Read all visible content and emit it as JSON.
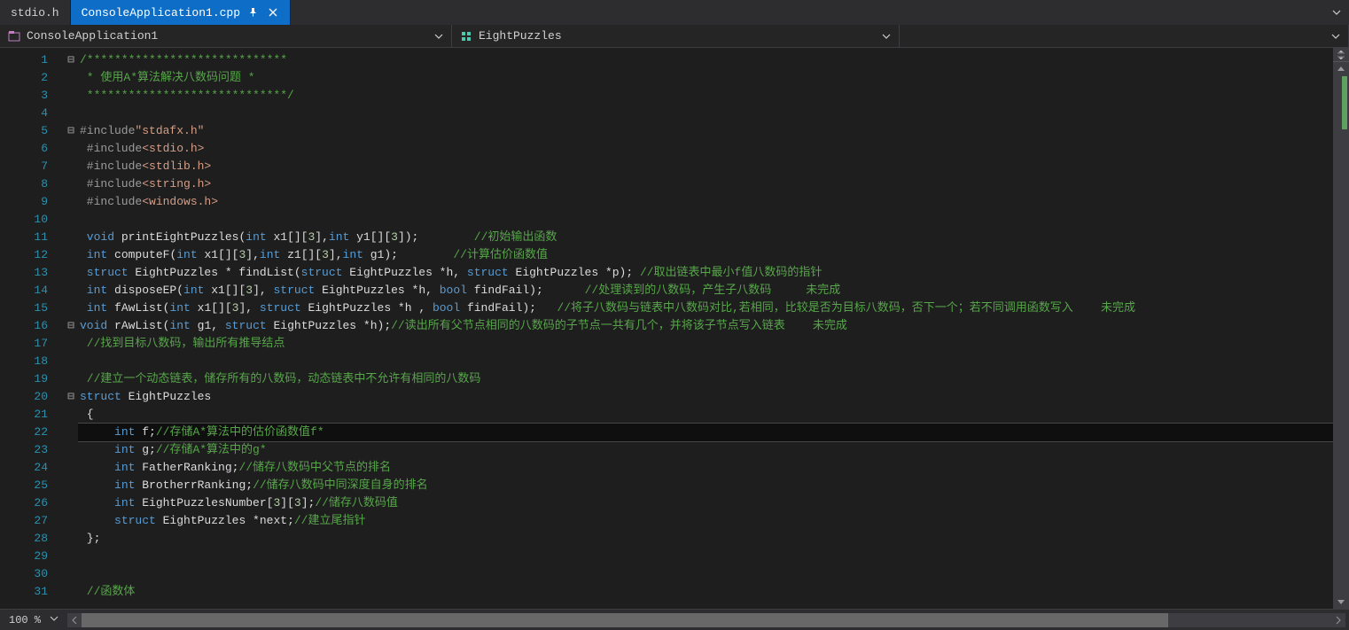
{
  "tabs": [
    {
      "label": "stdio.h",
      "active": false
    },
    {
      "label": "ConsoleApplication1.cpp",
      "active": true
    }
  ],
  "nav": {
    "scope": "ConsoleApplication1",
    "member": "EightPuzzles"
  },
  "zoom": "100 %",
  "lines": [
    {
      "n": 1,
      "fold": "⊟",
      "tokens": [
        [
          "c-comment",
          "/*****************************"
        ]
      ]
    },
    {
      "n": 2,
      "fold": "",
      "tokens": [
        [
          "c-comment",
          " * 使用A*算法解决八数码问题 *"
        ]
      ]
    },
    {
      "n": 3,
      "fold": "",
      "tokens": [
        [
          "c-comment",
          " *****************************/"
        ]
      ]
    },
    {
      "n": 4,
      "fold": "",
      "tokens": []
    },
    {
      "n": 5,
      "fold": "⊟",
      "tokens": [
        [
          "c-pre",
          "#include"
        ],
        [
          "c-string",
          "\"stdafx.h\""
        ]
      ]
    },
    {
      "n": 6,
      "fold": "",
      "tokens": [
        [
          "c-pre",
          " #include"
        ],
        [
          "c-string",
          "<stdio.h>"
        ]
      ]
    },
    {
      "n": 7,
      "fold": "",
      "tokens": [
        [
          "c-pre",
          " #include"
        ],
        [
          "c-string",
          "<stdlib.h>"
        ]
      ]
    },
    {
      "n": 8,
      "fold": "",
      "tokens": [
        [
          "c-pre",
          " #include"
        ],
        [
          "c-string",
          "<string.h>"
        ]
      ]
    },
    {
      "n": 9,
      "fold": "",
      "tokens": [
        [
          "c-pre",
          " #include"
        ],
        [
          "c-string",
          "<windows.h>"
        ]
      ]
    },
    {
      "n": 10,
      "fold": "",
      "tokens": []
    },
    {
      "n": 11,
      "fold": "",
      "tokens": [
        [
          "c-keyword",
          " void"
        ],
        [
          "c-func",
          " printEightPuzzles"
        ],
        [
          "c-punct",
          "("
        ],
        [
          "c-keyword",
          "int"
        ],
        [
          "c-func",
          " x1"
        ],
        [
          "c-punct",
          "[]["
        ],
        [
          "c-num",
          "3"
        ],
        [
          "c-punct",
          "],"
        ],
        [
          "c-keyword",
          "int"
        ],
        [
          "c-func",
          " y1"
        ],
        [
          "c-punct",
          "[]["
        ],
        [
          "c-num",
          "3"
        ],
        [
          "c-punct",
          "]);        "
        ],
        [
          "c-comment",
          "//初始输出函数"
        ]
      ]
    },
    {
      "n": 12,
      "fold": "",
      "tokens": [
        [
          "c-keyword",
          " int"
        ],
        [
          "c-func",
          " computeF"
        ],
        [
          "c-punct",
          "("
        ],
        [
          "c-keyword",
          "int"
        ],
        [
          "c-func",
          " x1"
        ],
        [
          "c-punct",
          "[]["
        ],
        [
          "c-num",
          "3"
        ],
        [
          "c-punct",
          "],"
        ],
        [
          "c-keyword",
          "int"
        ],
        [
          "c-func",
          " z1"
        ],
        [
          "c-punct",
          "[]["
        ],
        [
          "c-num",
          "3"
        ],
        [
          "c-punct",
          "],"
        ],
        [
          "c-keyword",
          "int"
        ],
        [
          "c-func",
          " g1"
        ],
        [
          "c-punct",
          ");        "
        ],
        [
          "c-comment",
          "//计算估价函数值"
        ]
      ]
    },
    {
      "n": 13,
      "fold": "",
      "tokens": [
        [
          "c-keyword",
          " struct"
        ],
        [
          "c-func",
          " EightPuzzles * findList"
        ],
        [
          "c-punct",
          "("
        ],
        [
          "c-keyword",
          "struct"
        ],
        [
          "c-func",
          " EightPuzzles *h"
        ],
        [
          "c-punct",
          ", "
        ],
        [
          "c-keyword",
          "struct"
        ],
        [
          "c-func",
          " EightPuzzles *p"
        ],
        [
          "c-punct",
          "); "
        ],
        [
          "c-comment",
          "//取出链表中最小f值八数码的指针"
        ]
      ]
    },
    {
      "n": 14,
      "fold": "",
      "tokens": [
        [
          "c-keyword",
          " int"
        ],
        [
          "c-func",
          " disposeEP"
        ],
        [
          "c-punct",
          "("
        ],
        [
          "c-keyword",
          "int"
        ],
        [
          "c-func",
          " x1"
        ],
        [
          "c-punct",
          "[]["
        ],
        [
          "c-num",
          "3"
        ],
        [
          "c-punct",
          "], "
        ],
        [
          "c-keyword",
          "struct"
        ],
        [
          "c-func",
          " EightPuzzles *h"
        ],
        [
          "c-punct",
          ", "
        ],
        [
          "c-keyword",
          "bool"
        ],
        [
          "c-func",
          " findFail"
        ],
        [
          "c-punct",
          ");      "
        ],
        [
          "c-comment",
          "//处理读到的八数码，产生子八数码     未完成"
        ]
      ]
    },
    {
      "n": 15,
      "fold": "",
      "tokens": [
        [
          "c-keyword",
          " int"
        ],
        [
          "c-func",
          " fAwList"
        ],
        [
          "c-punct",
          "("
        ],
        [
          "c-keyword",
          "int"
        ],
        [
          "c-func",
          " x1"
        ],
        [
          "c-punct",
          "[]["
        ],
        [
          "c-num",
          "3"
        ],
        [
          "c-punct",
          "], "
        ],
        [
          "c-keyword",
          "struct"
        ],
        [
          "c-func",
          " EightPuzzles *h "
        ],
        [
          "c-punct",
          ", "
        ],
        [
          "c-keyword",
          "bool"
        ],
        [
          "c-func",
          " findFail"
        ],
        [
          "c-punct",
          ");   "
        ],
        [
          "c-comment",
          "//将子八数码与链表中八数码对比,若相同，比较是否为目标八数码，否下一个；若不同调用函数写入    未完成"
        ]
      ]
    },
    {
      "n": 16,
      "fold": "⊟",
      "tokens": [
        [
          "c-keyword",
          "void"
        ],
        [
          "c-func",
          " rAwList"
        ],
        [
          "c-punct",
          "("
        ],
        [
          "c-keyword",
          "int"
        ],
        [
          "c-func",
          " g1"
        ],
        [
          "c-punct",
          ", "
        ],
        [
          "c-keyword",
          "struct"
        ],
        [
          "c-func",
          " EightPuzzles *h"
        ],
        [
          "c-punct",
          ");"
        ],
        [
          "c-comment",
          "//读出所有父节点相同的八数码的子节点一共有几个，并将该子节点写入链表    未完成"
        ]
      ]
    },
    {
      "n": 17,
      "fold": "",
      "tokens": [
        [
          "c-comment",
          " //找到目标八数码，输出所有推导结点"
        ]
      ]
    },
    {
      "n": 18,
      "fold": "",
      "tokens": []
    },
    {
      "n": 19,
      "fold": "",
      "tokens": [
        [
          "c-comment",
          " //建立一个动态链表，储存所有的八数码，动态链表中不允许有相同的八数码"
        ]
      ]
    },
    {
      "n": 20,
      "fold": "⊟",
      "tokens": [
        [
          "c-keyword",
          "struct"
        ],
        [
          "c-func",
          " EightPuzzles"
        ]
      ]
    },
    {
      "n": 21,
      "fold": "",
      "tokens": [
        [
          "c-punct",
          " {"
        ]
      ]
    },
    {
      "n": 22,
      "fold": "",
      "current": true,
      "tokens": [
        [
          "c-punct",
          "     "
        ],
        [
          "c-keyword",
          "int"
        ],
        [
          "c-func",
          " f"
        ],
        [
          "c-punct",
          ";"
        ],
        [
          "c-comment",
          "//存储A*算法中的估价函数值f*"
        ]
      ]
    },
    {
      "n": 23,
      "fold": "",
      "tokens": [
        [
          "c-punct",
          "     "
        ],
        [
          "c-keyword",
          "int"
        ],
        [
          "c-func",
          " g"
        ],
        [
          "c-punct",
          ";"
        ],
        [
          "c-comment",
          "//存储A*算法中的g*"
        ]
      ]
    },
    {
      "n": 24,
      "fold": "",
      "tokens": [
        [
          "c-punct",
          "     "
        ],
        [
          "c-keyword",
          "int"
        ],
        [
          "c-func",
          " FatherRanking"
        ],
        [
          "c-punct",
          ";"
        ],
        [
          "c-comment",
          "//储存八数码中父节点的排名"
        ]
      ]
    },
    {
      "n": 25,
      "fold": "",
      "tokens": [
        [
          "c-punct",
          "     "
        ],
        [
          "c-keyword",
          "int"
        ],
        [
          "c-func",
          " BrotherrRanking"
        ],
        [
          "c-punct",
          ";"
        ],
        [
          "c-comment",
          "//储存八数码中同深度自身的排名"
        ]
      ]
    },
    {
      "n": 26,
      "fold": "",
      "tokens": [
        [
          "c-punct",
          "     "
        ],
        [
          "c-keyword",
          "int"
        ],
        [
          "c-func",
          " EightPuzzlesNumber"
        ],
        [
          "c-punct",
          "["
        ],
        [
          "c-num",
          "3"
        ],
        [
          "c-punct",
          "]["
        ],
        [
          "c-num",
          "3"
        ],
        [
          "c-punct",
          "];"
        ],
        [
          "c-comment",
          "//储存八数码值"
        ]
      ]
    },
    {
      "n": 27,
      "fold": "",
      "tokens": [
        [
          "c-punct",
          "     "
        ],
        [
          "c-keyword",
          "struct"
        ],
        [
          "c-func",
          " EightPuzzles *next"
        ],
        [
          "c-punct",
          ";"
        ],
        [
          "c-comment",
          "//建立尾指针"
        ]
      ]
    },
    {
      "n": 28,
      "fold": "",
      "tokens": [
        [
          "c-punct",
          " };"
        ]
      ]
    },
    {
      "n": 29,
      "fold": "",
      "tokens": []
    },
    {
      "n": 30,
      "fold": "",
      "tokens": []
    },
    {
      "n": 31,
      "fold": "",
      "tokens": [
        [
          "c-comment",
          " //函数体"
        ]
      ]
    }
  ]
}
